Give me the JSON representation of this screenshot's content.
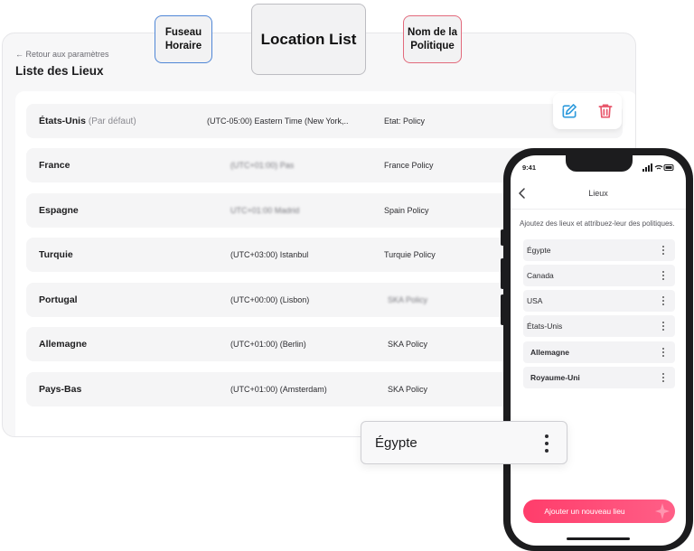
{
  "desktop": {
    "back_link": "← Retour aux paramètres",
    "title": "Liste des Lieux",
    "rows": [
      {
        "name": "États-Unis",
        "default_tag": "(Par défaut)",
        "timezone": "(UTC-05:00) Eastern Time (New York,..",
        "policy": "Etat: Policy"
      },
      {
        "name": "France",
        "timezone": "(UTC+01:00) Pas",
        "policy": "France Policy"
      },
      {
        "name": "Espagne",
        "timezone": "UTC+01:00 Madrid",
        "policy": "Spain Policy"
      },
      {
        "name": "Turquie",
        "timezone": "(UTC+03:00) Istanbul",
        "policy": "Turquie Policy"
      },
      {
        "name": "Portugal",
        "timezone": "(UTC+00:00) (Lisbon)",
        "policy": "SKA Policy"
      },
      {
        "name": "Allemagne",
        "timezone": "(UTC+01:00) (Berlin)",
        "policy": "SKA Policy"
      },
      {
        "name": "Pays-Bas",
        "timezone": "(UTC+01:00) (Amsterdam)",
        "policy": "SKA Policy"
      }
    ],
    "actions": {
      "edit_icon": "edit-icon",
      "delete_icon": "trash-icon"
    }
  },
  "callouts": {
    "fuseau": "Fuseau Horaire",
    "location_list": "Location List",
    "nom_politique": "Nom de la Politique"
  },
  "floating_item": {
    "label": "Égypte",
    "icon": "more-vertical-icon"
  },
  "mobile": {
    "status_time": "9:41",
    "nav_title": "Lieux",
    "intro": "Ajoutez des lieux et attribuez-leur des politiques.",
    "items": [
      "Égypte",
      "Canada",
      "USA",
      "États-Unis",
      "Allemagne",
      "Royaume-Uni"
    ],
    "cta_label": "Ajouter un nouveau lieu"
  },
  "colors": {
    "accent_blue": "#4f86d6",
    "accent_pink": "#e26a7c",
    "cta": "#ff3d6b",
    "edit_icon": "#2f9bdc",
    "delete_icon": "#e8556a"
  }
}
